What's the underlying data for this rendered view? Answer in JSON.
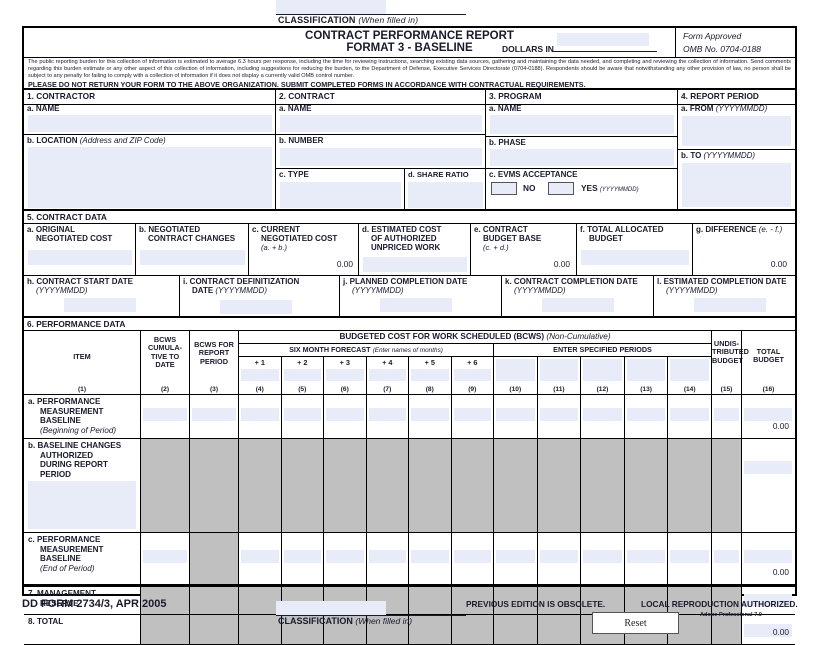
{
  "classification": {
    "label": "CLASSIFICATION",
    "note": "(When filled in)",
    "value": ""
  },
  "header": {
    "title_line1": "CONTRACT PERFORMANCE REPORT",
    "title_line2": "FORMAT 3 - BASELINE",
    "dollars_in_label": "DOLLARS IN",
    "dollars_in_value": "",
    "form_approved": "Form Approved",
    "omb_no": "OMB No. 0704-0188"
  },
  "burden": {
    "p1": "The public reporting burden for this collection of information is estimated to average 6.3 hours per response, including the time for reviewing instructions, searching existing data sources, gathering and maintaining the data needed, and completing and reviewing the collection of information.  Send comments regarding this burden estimate or any other aspect of this collection of information, including suggestions for reducing the burden, to the Department of Defense, Executive Services Directorate (0704-0188). Respondents should be aware that notwithstanding any other provision of law, no person shall be subject to any penalty for failing to comply with a collection of information if it does not display a currently valid OMB control number.",
    "p2": "PLEASE DO NOT RETURN YOUR FORM TO THE ABOVE ORGANIZATION.  SUBMIT COMPLETED FORMS IN ACCORDANCE WITH CONTRACTUAL REQUIREMENTS."
  },
  "s1": {
    "title": "1.  CONTRACTOR",
    "a_label": "a.  NAME",
    "a_value": "",
    "b_label": "b.  LOCATION",
    "b_note": "(Address and ZIP Code)",
    "b_value": ""
  },
  "s2": {
    "title": "2.  CONTRACT",
    "a_label": "a.  NAME",
    "a_value": "",
    "b_label": "b.  NUMBER",
    "b_value": "",
    "c_label": "c.  TYPE",
    "c_value": "",
    "d_label": "d.  SHARE RATIO",
    "d_value": ""
  },
  "s3": {
    "title": "3.  PROGRAM",
    "a_label": "a.  NAME",
    "a_value": "",
    "b_label": "b.  PHASE",
    "b_value": "",
    "c_label": "c.  EVMS ACCEPTANCE",
    "no_label": "NO",
    "no_value": "",
    "yes_label": "YES",
    "yes_note": "(YYYYMMDD)",
    "yes_value": ""
  },
  "s4": {
    "title": "4.  REPORT PERIOD",
    "a_label": "a.  FROM",
    "a_note": "(YYYYMMDD)",
    "a_value": "",
    "b_label": "b.  TO",
    "b_note": "(YYYYMMDD)",
    "b_value": ""
  },
  "s5": {
    "title": "5.  CONTRACT DATA",
    "a": {
      "label1": "a.  ORIGINAL",
      "label2": "NEGOTIATED COST",
      "value": ""
    },
    "b": {
      "label1": "b.  NEGOTIATED",
      "label2": "CONTRACT CHANGES",
      "value": ""
    },
    "c": {
      "label1": "c.  CURRENT",
      "label2": "NEGOTIATED COST",
      "note": "(a.  +  b.)",
      "value": "0.00"
    },
    "d": {
      "label1": "d.  ESTIMATED COST",
      "label2": "OF AUTHORIZED",
      "label3": "UNPRICED WORK",
      "value": ""
    },
    "e": {
      "label1": "e.  CONTRACT",
      "label2": "BUDGET BASE",
      "note": "(c.  +  d.)",
      "value": "0.00"
    },
    "f": {
      "label1": "f.  TOTAL ALLOCATED",
      "label2": "BUDGET",
      "value": ""
    },
    "g": {
      "label1": "g.  DIFFERENCE",
      "note": "(e. - f.)",
      "value": "0.00"
    },
    "h": {
      "label1": "h.  CONTRACT START DATE",
      "note": "(YYYYMMDD)",
      "value": ""
    },
    "i": {
      "label1": "i.  CONTRACT DEFINITIZATION",
      "label2": "DATE",
      "note": "(YYYYMMDD)",
      "value": ""
    },
    "j": {
      "label1": "j.  PLANNED COMPLETION DATE",
      "note": "(YYYYMMDD)",
      "value": ""
    },
    "k": {
      "label1": "k.  CONTRACT COMPLETION DATE",
      "note": "(YYYYMMDD)",
      "value": ""
    },
    "l": {
      "label1": "l.  ESTIMATED COMPLETION DATE",
      "note": "(YYYYMMDD)",
      "value": ""
    }
  },
  "s6": {
    "title": "6.  PERFORMANCE DATA",
    "col_item": "ITEM",
    "col_bcws_cum": "BCWS\nCUMULA-\nTIVE TO\nDATE",
    "col_bcws_rp": "BCWS FOR\nREPORT\nPERIOD",
    "group_bcws": "BUDGETED COST FOR WORK SCHEDULED (BCWS)",
    "group_bcws_note": "(Non-Cumulative)",
    "six_month": "SIX MONTH FORECAST",
    "six_month_note": "(Enter names of months)",
    "enter_periods": "ENTER SPECIFIED PERIODS",
    "col_undist": "UNDIS-\nTRIBUTED\nBUDGET",
    "col_total": "TOTAL\nBUDGET",
    "forecast_labels": [
      "+ 1",
      "+ 2",
      "+ 3",
      "+ 4",
      "+ 5",
      "+ 6"
    ],
    "specified_labels": [
      "",
      "",
      "",
      "",
      ""
    ],
    "col_numbers": [
      "(1)",
      "(2)",
      "(3)",
      "(4)",
      "(5)",
      "(6)",
      "(7)",
      "(8)",
      "(9)",
      "(10)",
      "(11)",
      "(12)",
      "(13)",
      "(14)",
      "(15)",
      "(16)"
    ],
    "rows": [
      {
        "label": "a.  PERFORMANCE\nMEASUREMENT\nBASELINE",
        "note": "(Beginning of Period)",
        "total": "0.00"
      },
      {
        "label": "b.  BASELINE CHANGES\nAUTHORIZED\nDURING REPORT\nPERIOD",
        "note": "",
        "total": ""
      },
      {
        "label": "c.  PERFORMANCE\nMEASUREMENT\nBASELINE",
        "note": "(End of Period)",
        "total": "0.00"
      },
      {
        "label": "7.  MANAGEMENT\nRESERVE",
        "note": "",
        "total": ""
      },
      {
        "label": "8.  TOTAL",
        "note": "",
        "total": "0.00"
      }
    ]
  },
  "footer": {
    "form_id": "DD FORM 2734/3, APR 2005",
    "prev_edition": "PREVIOUS EDITION IS OBSOLETE.",
    "local_repro": "LOCAL REPRODUCTION AUTHORIZED.",
    "adobe": "Adobe Professional 7.0",
    "reset_label": "Reset"
  },
  "colors": {
    "field_fill": "#e8ecf8",
    "disabled_fill": "#c0c0c0",
    "rule": "#000000"
  }
}
